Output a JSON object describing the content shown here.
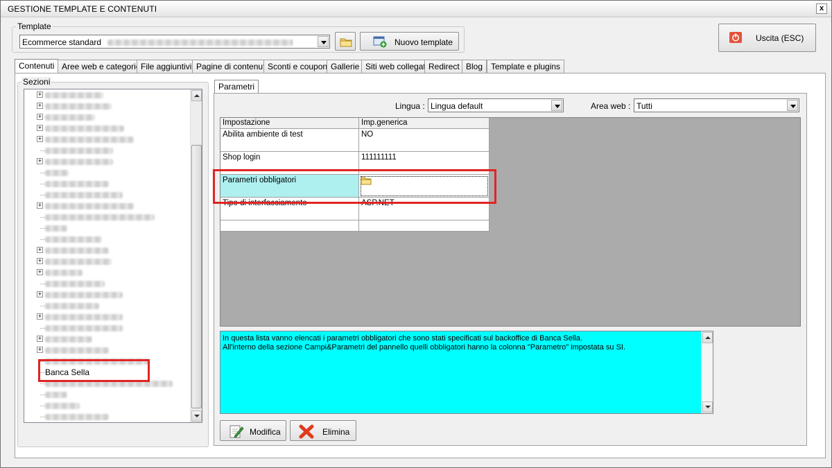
{
  "window": {
    "title": "GESTIONE TEMPLATE E CONTENUTI",
    "close_glyph": "x"
  },
  "template_group": {
    "label": "Template",
    "selected": "Ecommerce standard",
    "new_button": "Nuovo template"
  },
  "exit_button": "Uscita (ESC)",
  "tabs": [
    {
      "label": "Contenuti",
      "active": true
    },
    {
      "label": "Aree web e categorie"
    },
    {
      "label": "File aggiuntivi"
    },
    {
      "label": "Pagine di contenuti"
    },
    {
      "label": "Sconti e coupon"
    },
    {
      "label": "Gallerie"
    },
    {
      "label": "Siti web collegati"
    },
    {
      "label": "Redirect"
    },
    {
      "label": "Blog"
    },
    {
      "label": "Template e plugins"
    }
  ],
  "sections": {
    "label": "Sezioni",
    "selected_item": "Banca Sella"
  },
  "params_tab": {
    "label": "Parametri"
  },
  "filters": {
    "lingua_label": "Lingua :",
    "lingua_value": "Lingua default",
    "area_label": "Area web :",
    "area_value": "Tutti"
  },
  "grid": {
    "headers": [
      "Impostazione",
      "Imp.generica"
    ],
    "rows": [
      {
        "name": "Abilita ambiente di test",
        "value": "NO"
      },
      {
        "name": "Shop login",
        "value": "111111111"
      },
      {
        "name": "Parametri obbligatori",
        "value": ""
      },
      {
        "name": "Tipo di interfacciamento",
        "value": "ASP.NET"
      },
      {
        "name": "",
        "value": ""
      }
    ]
  },
  "description": {
    "line1": "In questa lista vanno elencati i parametri obbligatori che sono stati specificati sul backoffice di Banca Sella.",
    "line2": "All'interno della sezione Campi&Parametri del pannello quelli obbligatori hanno la colonna \"Parametro\" impostata su SI."
  },
  "actions": {
    "modify": "Modifica",
    "delete": "Elimina"
  },
  "colors": {
    "highlight_red": "#e02424",
    "description_bg": "#00ffff",
    "selected_row_bg": "#aef0f0"
  }
}
